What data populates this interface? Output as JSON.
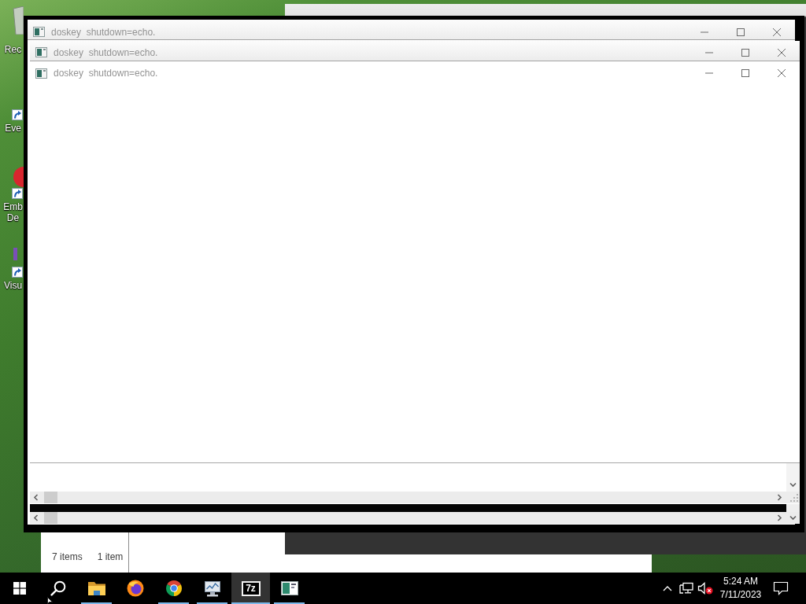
{
  "desktop": {
    "icons": [
      {
        "kind": "recycle_bin",
        "label": "Rec"
      },
      {
        "kind": "shortcut",
        "label": "Eve"
      },
      {
        "kind": "shortcut",
        "label": "Emb De"
      },
      {
        "kind": "shortcut",
        "label": "Visu"
      }
    ]
  },
  "background_windows": [
    {
      "kind": "explorer",
      "status": [
        "7 items",
        "1 item"
      ]
    },
    {
      "kind": "blank"
    },
    {
      "kind": "dark"
    }
  ],
  "windows": [
    {
      "title": "doskey  shutdown=echo."
    },
    {
      "title": "doskey  shutdown=echo."
    },
    {
      "title": "doskey  shutdown=echo."
    }
  ],
  "taskbar": {
    "buttons": [
      {
        "kind": "start",
        "running": false,
        "selected": false
      },
      {
        "kind": "search",
        "running": false,
        "selected": false
      },
      {
        "kind": "file_explorer",
        "running": true,
        "selected": false
      },
      {
        "kind": "firefox",
        "running": false,
        "selected": false
      },
      {
        "kind": "chrome",
        "running": true,
        "selected": false
      },
      {
        "kind": "monitor_app",
        "running": true,
        "selected": false
      },
      {
        "kind": "archiver",
        "label": "7z",
        "running": true,
        "selected": true
      },
      {
        "kind": "window_app",
        "running": true,
        "selected": false
      }
    ],
    "tray": {
      "muted": true,
      "time": "5:24 AM",
      "date": "7/11/2023"
    }
  }
}
